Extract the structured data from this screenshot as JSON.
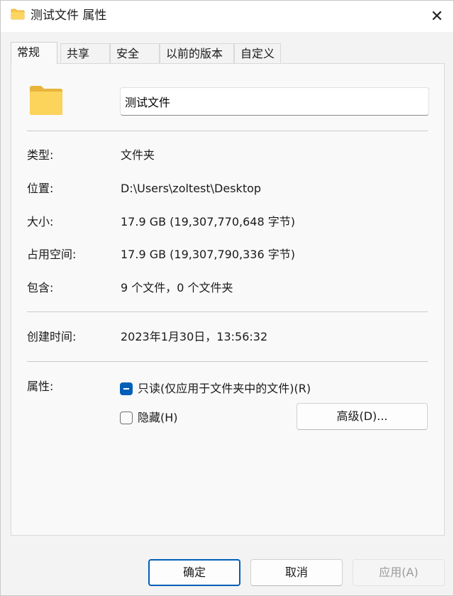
{
  "window": {
    "title": "测试文件 属性",
    "close_glyph": "✕"
  },
  "tabs": [
    {
      "label": "常规",
      "active": true
    },
    {
      "label": "共享",
      "active": false
    },
    {
      "label": "安全",
      "active": false
    },
    {
      "label": "以前的版本",
      "active": false
    },
    {
      "label": "自定义",
      "active": false
    }
  ],
  "general": {
    "name_value": "测试文件",
    "rows": [
      {
        "label": "类型:",
        "value": "文件夹"
      },
      {
        "label": "位置:",
        "value": "D:\\Users\\zoltest\\Desktop"
      },
      {
        "label": "大小:",
        "value": "17.9 GB (19,307,770,648 字节)"
      },
      {
        "label": "占用空间:",
        "value": "17.9 GB (19,307,790,336 字节)"
      },
      {
        "label": "包含:",
        "value": "9 个文件，0 个文件夹"
      }
    ],
    "created_label": "创建时间:",
    "created_value": "2023年1月30日，13:56:32",
    "attributes_label": "属性:",
    "readonly_label": "只读(仅应用于文件夹中的文件)(R)",
    "readonly_state": "indeterminate",
    "hidden_label": "隐藏(H)",
    "hidden_state": "unchecked",
    "advanced_label": "高级(D)..."
  },
  "footer": {
    "ok_label": "确定",
    "cancel_label": "取消",
    "apply_label": "应用(A)"
  },
  "colors": {
    "accent": "#005fb8",
    "folder": "#f8c846"
  },
  "icons": [
    "folder-icon",
    "close-icon"
  ]
}
